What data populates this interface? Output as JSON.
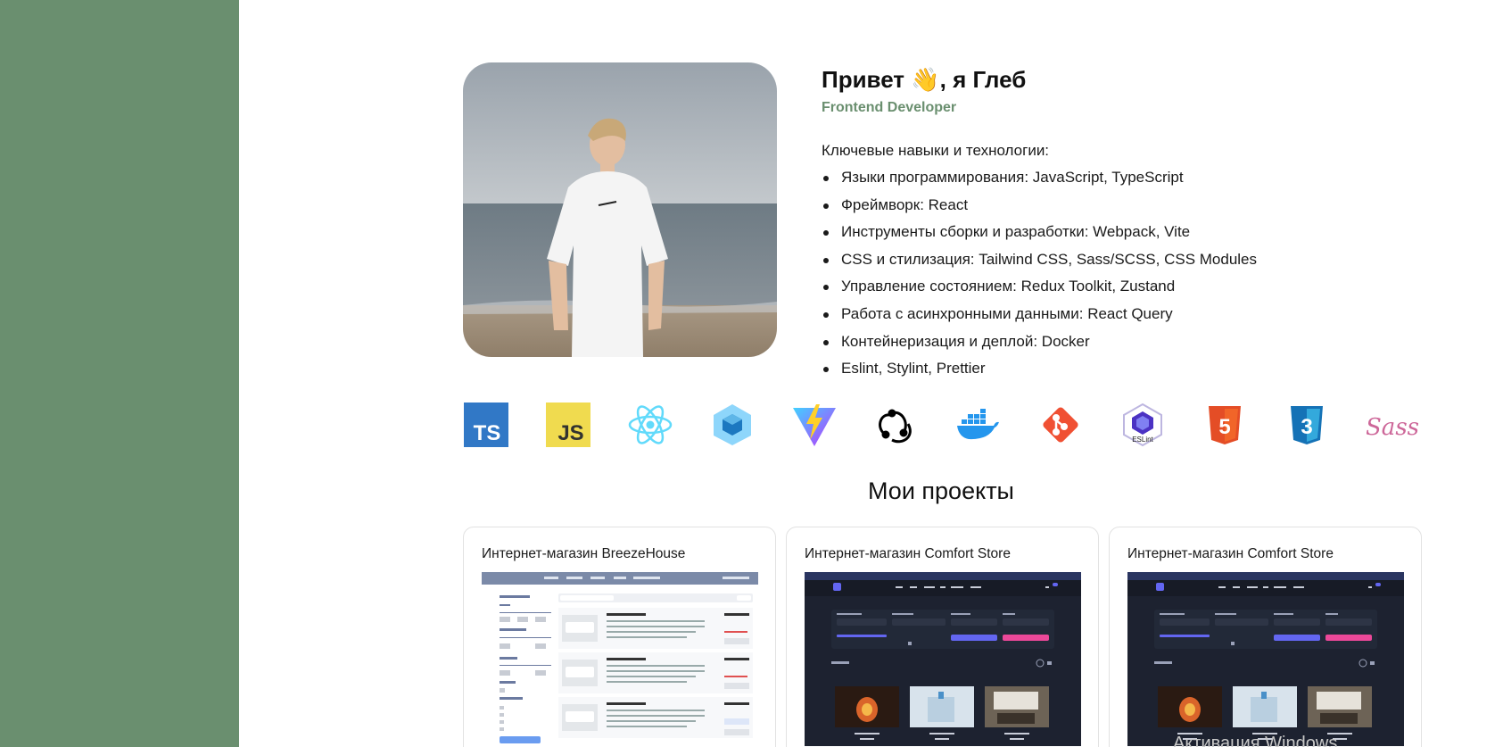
{
  "hero": {
    "greeting": "Привет 👋, я Глеб",
    "role": "Frontend Developer",
    "skills_intro": "Ключевые навыки и технологии:",
    "skills": [
      "Языки программирования: JavaScript, TypeScript",
      "Фреймворк: React",
      "Инструменты сборки и разработки: Webpack, Vite",
      "CSS и стилизация: Tailwind CSS, Sass/SCSS, CSS Modules",
      "Управление состоянием: Redux Toolkit, Zustand",
      "Работа с асинхронными данными: React Query",
      "Контейнеризация и деплой: Docker",
      "Eslint, Stylint, Prettier"
    ]
  },
  "tech_icons": [
    {
      "icon": "typescript-icon",
      "text": "TS",
      "color": "#3178c6"
    },
    {
      "icon": "javascript-icon",
      "text": "JS",
      "color": "#f0db4f"
    },
    {
      "icon": "react-icon",
      "color": "#61dafb"
    },
    {
      "icon": "webpack-icon",
      "color": "#8ed6fb"
    },
    {
      "icon": "vite-icon",
      "color": "#9f6bfe"
    },
    {
      "icon": "redux-icon",
      "color": "#000000"
    },
    {
      "icon": "docker-icon",
      "color": "#2496ed"
    },
    {
      "icon": "git-icon",
      "color": "#f05033"
    },
    {
      "icon": "eslint-icon",
      "text": "ESLint",
      "color": "#4b32c3"
    },
    {
      "icon": "html5-icon",
      "text": "5",
      "color": "#e44d26"
    },
    {
      "icon": "css3-icon",
      "text": "3",
      "color": "#1572b6"
    },
    {
      "icon": "sass-icon",
      "text": "Sass",
      "color": "#cd6799"
    }
  ],
  "projects": {
    "title": "Мои проекты",
    "items": [
      {
        "title": "Интернет-магазин BreezeHouse"
      },
      {
        "title": "Интернет-магазин Comfort Store"
      },
      {
        "title": "Интернет-магазин Comfort Store"
      }
    ]
  },
  "watermark": "Активация Windows",
  "colors": {
    "sidebar": "#6a8f6f",
    "accent": "#6a8f6f"
  }
}
